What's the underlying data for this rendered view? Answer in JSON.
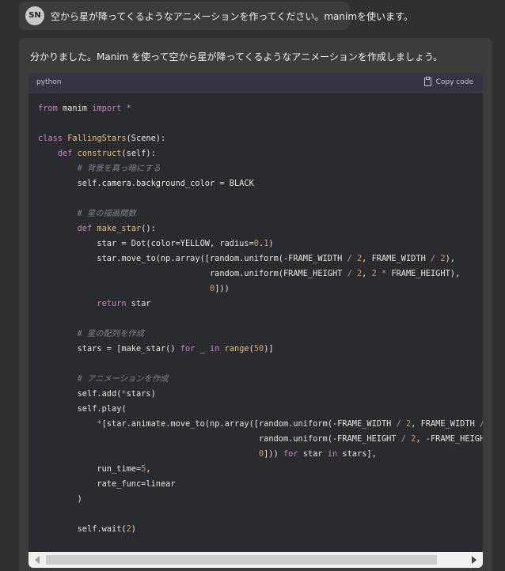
{
  "user_message": {
    "avatar_initials": "SN",
    "text": "空から星が降ってくるようなアニメーションを作ってください。manimを使います。"
  },
  "assistant_message": {
    "intro": "分かりました。Manim を使って空から星が降ってくるようなアニメーションを作成しましょう。",
    "code_block": {
      "language": "python",
      "copy_label": "Copy code"
    }
  },
  "code_lines": [
    "from manim import *",
    "",
    "class FallingStars(Scene):",
    "    def construct(self):",
    "        # 背景を真っ暗にする",
    "        self.camera.background_color = BLACK",
    "",
    "        # 星の描画関数",
    "        def make_star():",
    "            star = Dot(color=YELLOW, radius=0.1)",
    "            star.move_to(np.array([random.uniform(-FRAME_WIDTH / 2, FRAME_WIDTH / 2),",
    "                                   random.uniform(FRAME_HEIGHT / 2, 2 * FRAME_HEIGHT),",
    "                                   0]))",
    "            return star",
    "",
    "        # 星の配列を作成",
    "        stars = [make_star() for _ in range(50)]",
    "",
    "        # アニメーションを作成",
    "        self.add(*stars)",
    "        self.play(",
    "            *[star.animate.move_to(np.array([random.uniform(-FRAME_WIDTH / 2, FRAME_WIDTH /",
    "                                             random.uniform(-FRAME_HEIGHT / 2, -FRAME_HEIGHT",
    "                                             0])) for star in stars],",
    "            run_time=5,",
    "            rate_func=linear",
    "        )",
    "",
    "        self.wait(2)"
  ],
  "colors": {
    "page_background": "#303030",
    "code_background": "#2a2b2e",
    "keyword": "#c586c0",
    "function_name": "#e5c07b",
    "number": "#d19a66",
    "comment": "#7f848e"
  }
}
